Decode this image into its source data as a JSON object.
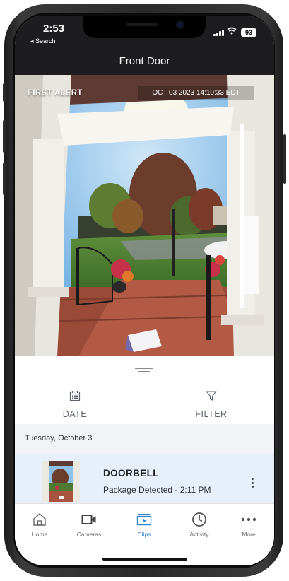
{
  "status_bar": {
    "time": "2:53",
    "back_label": "◂ Search",
    "battery": "93"
  },
  "header": {
    "title": "Front Door"
  },
  "video": {
    "watermark": "FIRST ALERT",
    "timestamp": "OCT 03 2023 14:10:33 EDT"
  },
  "filters": {
    "date_label": "DATE",
    "filter_label": "FILTER"
  },
  "clips": {
    "date_header": "Tuesday, October 3",
    "items": [
      {
        "title": "DOORBELL",
        "subtitle": "Package Detected - 2:11 PM"
      }
    ]
  },
  "tabbar": {
    "items": [
      {
        "label": "Home",
        "icon": "home-icon",
        "active": false
      },
      {
        "label": "Cameras",
        "icon": "video-camera-icon",
        "active": false
      },
      {
        "label": "Clips",
        "icon": "clips-icon",
        "active": true
      },
      {
        "label": "Activity",
        "icon": "clock-icon",
        "active": false
      },
      {
        "label": "More",
        "icon": "more-dots-icon",
        "active": false
      }
    ]
  },
  "colors": {
    "accent": "#2f86d3",
    "header_bg": "#1d1d1f",
    "selected_row_bg": "#e7f0fa"
  }
}
